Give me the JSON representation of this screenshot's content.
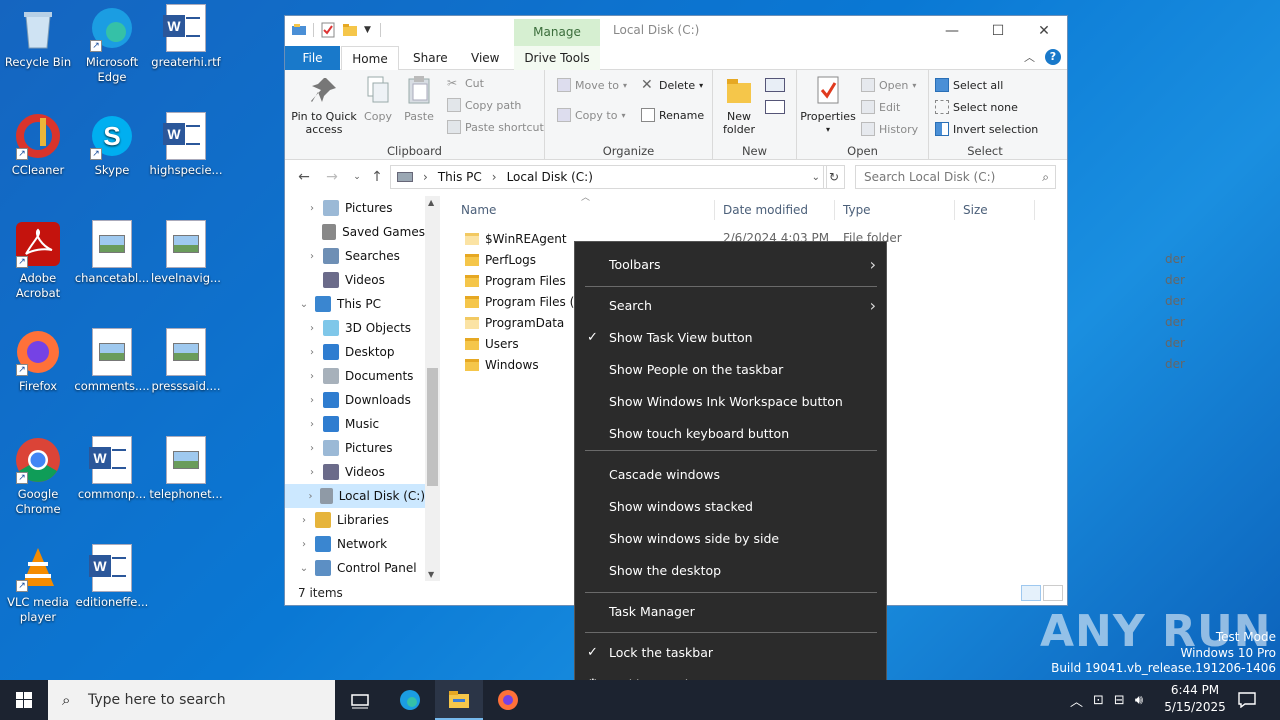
{
  "desktop": {
    "icons": [
      {
        "label": "Recycle Bin",
        "icon": "recycle-bin-icon"
      },
      {
        "label": "Microsoft Edge",
        "icon": "edge-icon"
      },
      {
        "label": "greaterhi.rtf",
        "icon": "word-doc-icon"
      },
      {
        "label": "CCleaner",
        "icon": "ccleaner-icon"
      },
      {
        "label": "Skype",
        "icon": "skype-icon"
      },
      {
        "label": "highspecie...",
        "icon": "word-doc-icon"
      },
      {
        "label": "Adobe Acrobat",
        "icon": "acrobat-icon"
      },
      {
        "label": "chancetabl...",
        "icon": "image-file-icon"
      },
      {
        "label": "levelnavig...",
        "icon": "image-file-icon"
      },
      {
        "label": "Firefox",
        "icon": "firefox-icon"
      },
      {
        "label": "comments....",
        "icon": "image-file-icon"
      },
      {
        "label": "presssaid....",
        "icon": "image-file-icon"
      },
      {
        "label": "Google Chrome",
        "icon": "chrome-icon"
      },
      {
        "label": "commonp...",
        "icon": "word-doc-icon"
      },
      {
        "label": "telephonet...",
        "icon": "image-file-icon"
      },
      {
        "label": "VLC media player",
        "icon": "vlc-icon"
      },
      {
        "label": "editioneffe...",
        "icon": "word-doc-icon"
      }
    ]
  },
  "explorer": {
    "title": "Local Disk (C:)",
    "manage_tab": "Manage",
    "tabs": {
      "file": "File",
      "home": "Home",
      "share": "Share",
      "view": "View",
      "drive_tools": "Drive Tools"
    },
    "ribbon": {
      "clipboard": {
        "label": "Clipboard",
        "pin": "Pin to Quick access",
        "copy": "Copy",
        "paste": "Paste",
        "cut": "Cut",
        "copy_path": "Copy path",
        "paste_shortcut": "Paste shortcut"
      },
      "organize": {
        "label": "Organize",
        "move_to": "Move to",
        "copy_to": "Copy to",
        "delete": "Delete",
        "rename": "Rename"
      },
      "new": {
        "label": "New",
        "new_folder": "New folder"
      },
      "open": {
        "label": "Open",
        "properties": "Properties",
        "open": "Open",
        "edit": "Edit",
        "history": "History"
      },
      "select": {
        "label": "Select",
        "select_all": "Select all",
        "select_none": "Select none",
        "invert": "Invert selection"
      }
    },
    "address": {
      "crumbs": [
        "This PC",
        "Local Disk (C:)"
      ]
    },
    "search_placeholder": "Search Local Disk (C:)",
    "nav": [
      {
        "label": "Pictures",
        "indent": 1,
        "expand": true
      },
      {
        "label": "Saved Games",
        "indent": 1,
        "expand": false
      },
      {
        "label": "Searches",
        "indent": 1,
        "expand": true
      },
      {
        "label": "Videos",
        "indent": 1,
        "expand": false
      },
      {
        "label": "This PC",
        "indent": 0,
        "expand": true,
        "open": true
      },
      {
        "label": "3D Objects",
        "indent": 1,
        "expand": true
      },
      {
        "label": "Desktop",
        "indent": 1,
        "expand": true
      },
      {
        "label": "Documents",
        "indent": 1,
        "expand": true
      },
      {
        "label": "Downloads",
        "indent": 1,
        "expand": true
      },
      {
        "label": "Music",
        "indent": 1,
        "expand": true
      },
      {
        "label": "Pictures",
        "indent": 1,
        "expand": true
      },
      {
        "label": "Videos",
        "indent": 1,
        "expand": true
      },
      {
        "label": "Local Disk (C:)",
        "indent": 1,
        "expand": true,
        "selected": true
      },
      {
        "label": "Libraries",
        "indent": 0,
        "expand": true
      },
      {
        "label": "Network",
        "indent": 0,
        "expand": true
      },
      {
        "label": "Control Panel",
        "indent": 0,
        "expand": true,
        "open": true
      }
    ],
    "columns": {
      "name": "Name",
      "date": "Date modified",
      "type": "Type",
      "size": "Size"
    },
    "files": [
      {
        "name": "$WinREAgent",
        "date": "2/6/2024 4:03 PM",
        "type": "File folder"
      },
      {
        "name": "PerfLogs",
        "date": "",
        "type": "der"
      },
      {
        "name": "Program Files",
        "date": "",
        "type": "der"
      },
      {
        "name": "Program Files (x8",
        "date": "",
        "type": "der"
      },
      {
        "name": "ProgramData",
        "date": "",
        "type": "der"
      },
      {
        "name": "Users",
        "date": "",
        "type": "der"
      },
      {
        "name": "Windows",
        "date": "",
        "type": "der"
      }
    ],
    "status": "7 items"
  },
  "context_menu": {
    "items": [
      {
        "label": "Toolbars",
        "submenu": true
      },
      {
        "label": "Search",
        "submenu": true
      },
      {
        "label": "Show Task View button",
        "checked": true
      },
      {
        "label": "Show People on the taskbar"
      },
      {
        "label": "Show Windows Ink Workspace button"
      },
      {
        "label": "Show touch keyboard button"
      },
      {
        "label": "Cascade windows"
      },
      {
        "label": "Show windows stacked"
      },
      {
        "label": "Show windows side by side"
      },
      {
        "label": "Show the desktop"
      },
      {
        "label": "Task Manager"
      },
      {
        "label": "Lock the taskbar",
        "checked": true
      },
      {
        "label": "Taskbar settings",
        "gear": true
      }
    ]
  },
  "watermark": {
    "brand": "ANY RUN",
    "test_mode": "Test Mode",
    "edition": "Windows 10 Pro",
    "build": "Build 19041.vb_release.191206-1406"
  },
  "taskbar": {
    "search_placeholder": "Type here to search",
    "time": "6:44 PM",
    "date": "5/15/2025"
  },
  "colors": {
    "accent": "#1979ca",
    "menu_bg": "#2b2b2b",
    "taskbar": "#1c2330"
  }
}
